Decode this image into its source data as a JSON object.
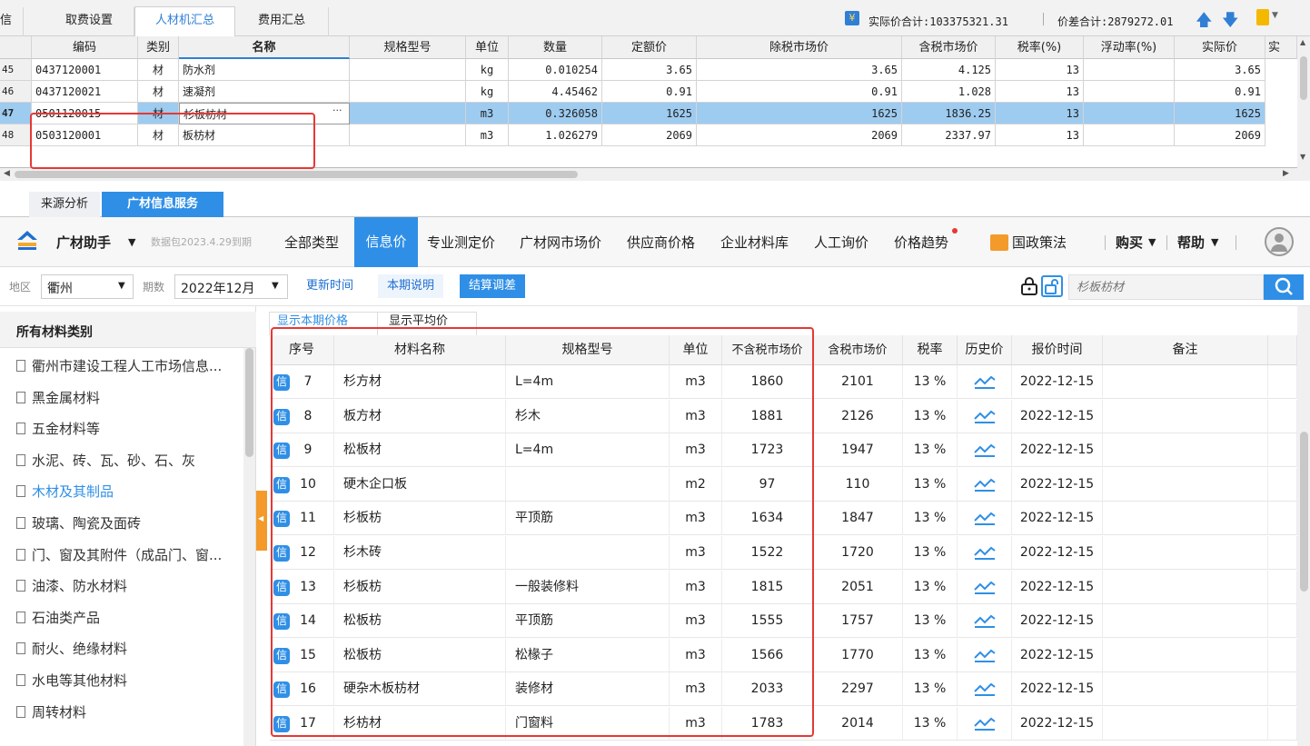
{
  "top_tabs": [
    {
      "label": "信息"
    },
    {
      "label": "取费设置"
    },
    {
      "label": "人材机汇总"
    },
    {
      "label": "费用汇总"
    }
  ],
  "summary": {
    "actual_total": "实际价合计:103375321.31",
    "diff_total": "价差合计:2879272.01"
  },
  "grid1": {
    "headers": [
      "编码",
      "类别",
      "名称",
      "规格型号",
      "单位",
      "数量",
      "定额价",
      "除税市场价",
      "含税市场价",
      "税率(%)",
      "浮动率(%)",
      "实际价",
      "实"
    ],
    "rows": [
      {
        "no": "45",
        "code": "0437120001",
        "type": "材",
        "name": "防水剂",
        "spec": "",
        "unit": "kg",
        "qty": "0.010254",
        "quota": "3.65",
        "excl": "3.65",
        "incl": "4.125",
        "tax": "13",
        "float": "",
        "actual": "3.65"
      },
      {
        "no": "46",
        "code": "0437120021",
        "type": "材",
        "name": "速凝剂",
        "spec": "",
        "unit": "kg",
        "qty": "4.45462",
        "quota": "0.91",
        "excl": "0.91",
        "incl": "1.028",
        "tax": "13",
        "float": "",
        "actual": "0.91"
      },
      {
        "no": "47",
        "code": "0501120015",
        "type": "材",
        "name": "杉板枋材",
        "spec": "",
        "unit": "m3",
        "qty": "0.326058",
        "quota": "1625",
        "excl": "1625",
        "incl": "1836.25",
        "tax": "13",
        "float": "",
        "actual": "1625"
      },
      {
        "no": "48",
        "code": "0503120001",
        "type": "材",
        "name": "板枋材",
        "spec": "",
        "unit": "m3",
        "qty": "1.026279",
        "quota": "2069",
        "excl": "2069",
        "incl": "2337.97",
        "tax": "13",
        "float": "",
        "actual": "2069"
      }
    ],
    "ellipsis": "···"
  },
  "mid_tabs": [
    {
      "label": "来源分析"
    },
    {
      "label": "广材信息服务"
    }
  ],
  "toolbar": {
    "assistant": "广材助手",
    "caret": "▼",
    "package": "数据包2023.4.29到期",
    "items": [
      "全部类型",
      "信息价",
      "专业测定价",
      "广材网市场价",
      "供应商价格",
      "企业材料库",
      "人工询价",
      "价格趋势"
    ],
    "policy": "国政策法",
    "buy": "购买",
    "help": "帮助"
  },
  "filter": {
    "region_label": "地区",
    "region": "衢州",
    "period_label": "期数",
    "period": "2022年12月",
    "update_btn": "更新时间",
    "desc_btn": "本期说明",
    "settle_btn": "结算调差",
    "search_placeholder": "杉板枋材"
  },
  "left": {
    "title": "所有材料类别",
    "items": [
      "衢州市建设工程人工市场信息...",
      "黑金属材料",
      "五金材料等",
      "水泥、砖、瓦、砂、石、灰",
      "木材及其制品",
      "玻璃、陶瓷及面砖",
      "门、窗及其附件（成品门、窗...",
      "油漆、防水材料",
      "石油类产品",
      "耐火、绝缘材料",
      "水电等其他材料",
      "周转材料"
    ],
    "active_index": 4
  },
  "subtabs": [
    {
      "label": "显示本期价格"
    },
    {
      "label": "显示平均价"
    }
  ],
  "table": {
    "headers": [
      "序号",
      "材料名称",
      "规格型号",
      "单位",
      "不含税市场价",
      "含税市场价",
      "税率",
      "历史价",
      "报价时间",
      "备注"
    ],
    "badge": "信",
    "rows": [
      {
        "no": "7",
        "name": "杉方材",
        "spec": "L=4m",
        "unit": "m3",
        "excl": "1860",
        "incl": "2101",
        "tax": "13 %",
        "date": "2022-12-15"
      },
      {
        "no": "8",
        "name": "板方材",
        "spec": "杉木",
        "unit": "m3",
        "excl": "1881",
        "incl": "2126",
        "tax": "13 %",
        "date": "2022-12-15"
      },
      {
        "no": "9",
        "name": "松板材",
        "spec": "L=4m",
        "unit": "m3",
        "excl": "1723",
        "incl": "1947",
        "tax": "13 %",
        "date": "2022-12-15"
      },
      {
        "no": "10",
        "name": "硬木企口板",
        "spec": "",
        "unit": "m2",
        "excl": "97",
        "incl": "110",
        "tax": "13 %",
        "date": "2022-12-15"
      },
      {
        "no": "11",
        "name": "杉板枋",
        "spec": "平顶筋",
        "unit": "m3",
        "excl": "1634",
        "incl": "1847",
        "tax": "13 %",
        "date": "2022-12-15"
      },
      {
        "no": "12",
        "name": "杉木砖",
        "spec": "",
        "unit": "m3",
        "excl": "1522",
        "incl": "1720",
        "tax": "13 %",
        "date": "2022-12-15"
      },
      {
        "no": "13",
        "name": "杉板枋",
        "spec": "一般装修料",
        "unit": "m3",
        "excl": "1815",
        "incl": "2051",
        "tax": "13 %",
        "date": "2022-12-15"
      },
      {
        "no": "14",
        "name": "松板枋",
        "spec": "平顶筋",
        "unit": "m3",
        "excl": "1555",
        "incl": "1757",
        "tax": "13 %",
        "date": "2022-12-15"
      },
      {
        "no": "15",
        "name": "松板枋",
        "spec": "松椽子",
        "unit": "m3",
        "excl": "1566",
        "incl": "1770",
        "tax": "13 %",
        "date": "2022-12-15"
      },
      {
        "no": "16",
        "name": "硬杂木板枋材",
        "spec": "装修材",
        "unit": "m3",
        "excl": "2033",
        "incl": "2297",
        "tax": "13 %",
        "date": "2022-12-15"
      },
      {
        "no": "17",
        "name": "杉枋材",
        "spec": "门窗料",
        "unit": "m3",
        "excl": "1783",
        "incl": "2014",
        "tax": "13 %",
        "date": "2022-12-15"
      }
    ]
  },
  "colors": {
    "accent": "#2f8fe6",
    "selected_row": "#9ecbf0",
    "highlight": "#e53935",
    "orange": "#f39a2b"
  }
}
